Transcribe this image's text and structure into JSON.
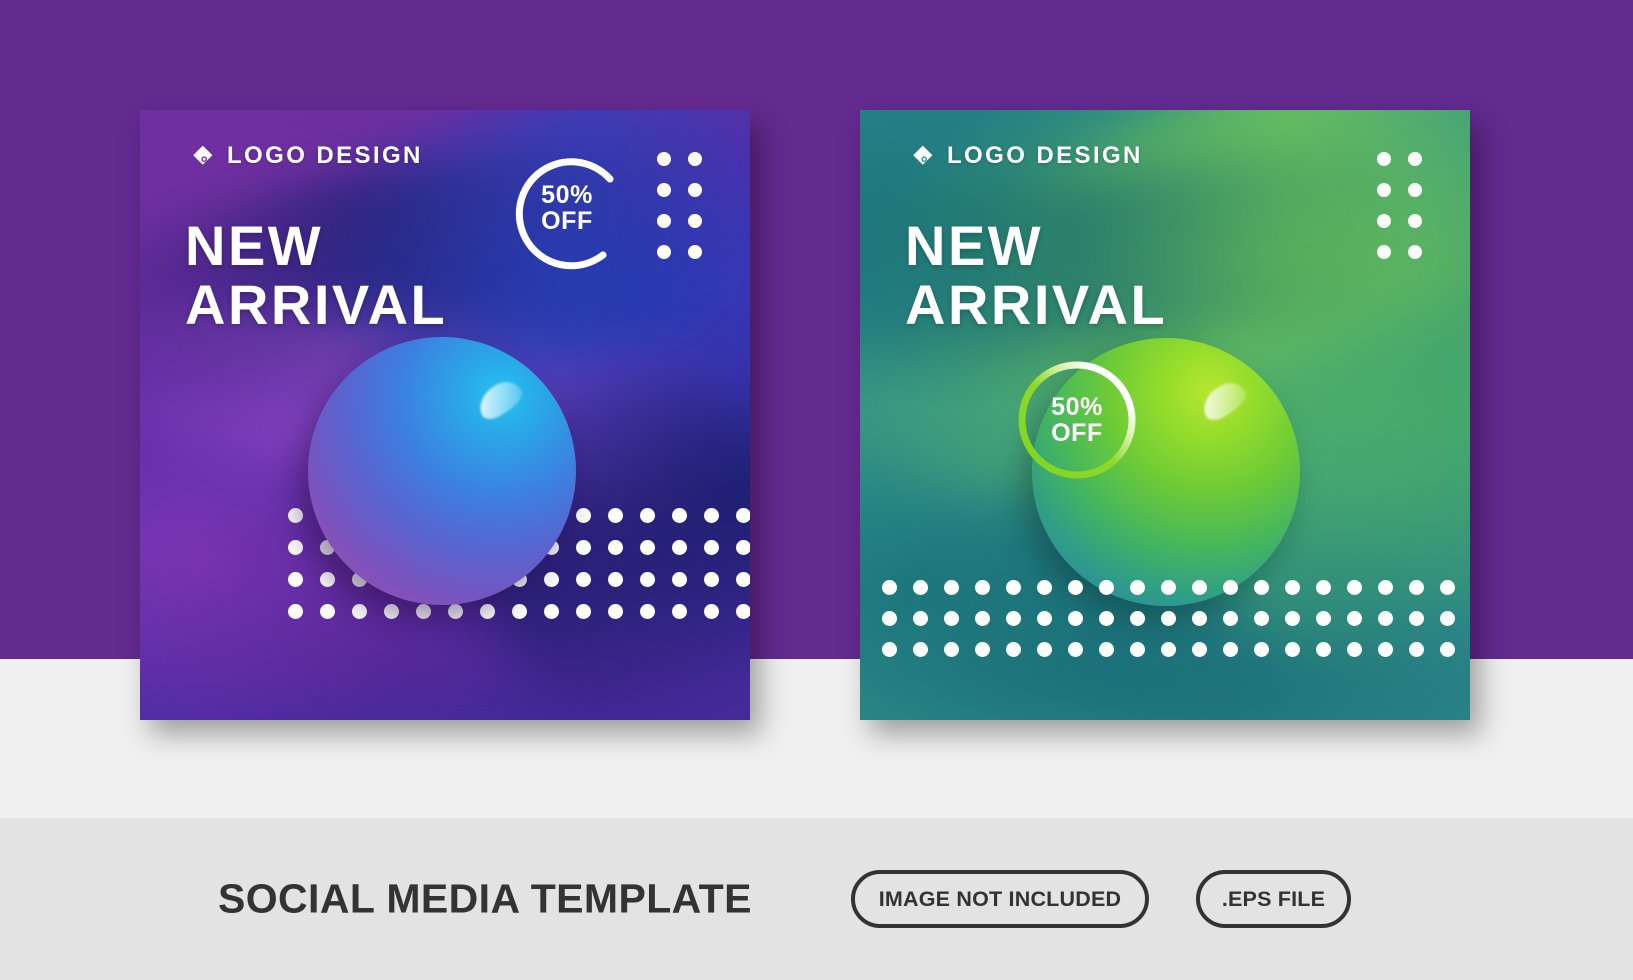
{
  "page": {
    "background_color": "#632a90",
    "strip_color": "#f0f0f0",
    "footer_color": "#e3e3e3"
  },
  "cards": [
    {
      "id": "purple-card",
      "theme": "purple",
      "logo": {
        "icon": "tag-diamond-icon",
        "text": "LOGO DESIGN"
      },
      "headline": {
        "line1": "NEW",
        "line2": "ARRIVAL"
      },
      "badge": {
        "percent": "50%",
        "off": "OFF",
        "ring_color": "#ffffff"
      },
      "sphere": {
        "color_top": "#23c3f0",
        "color_bottom": "#a04da8"
      },
      "dots": {
        "top_right_cols": 2,
        "top_right_rows": 4,
        "bottom_cols": 16,
        "bottom_rows": 4,
        "color": "#fdfdfb"
      },
      "bg_colors": [
        "#6d2fa0",
        "#4c2da8",
        "#1a2278"
      ]
    },
    {
      "id": "green-card",
      "theme": "green",
      "logo": {
        "icon": "tag-diamond-icon",
        "text": "LOGO DESIGN"
      },
      "headline": {
        "line1": "NEW",
        "line2": "ARRIVAL"
      },
      "badge": {
        "percent": "50%",
        "off": "OFF",
        "ring_color": "#7ed321"
      },
      "sphere": {
        "color_top": "#b7e52e",
        "color_bottom": "#2f7fae"
      },
      "dots": {
        "top_right_cols": 2,
        "top_right_rows": 4,
        "bottom_cols": 19,
        "bottom_rows": 3,
        "color": "#fdfdfb"
      },
      "bg_colors": [
        "#2b8a90",
        "#2f8f86",
        "#7ccf52"
      ]
    }
  ],
  "footer": {
    "title": "SOCIAL MEDIA TEMPLATE",
    "pills": [
      {
        "id": "image-not-included",
        "label": "IMAGE NOT INCLUDED"
      },
      {
        "id": "eps-file",
        "label": ".EPS FILE"
      }
    ],
    "text_color": "#333333"
  }
}
